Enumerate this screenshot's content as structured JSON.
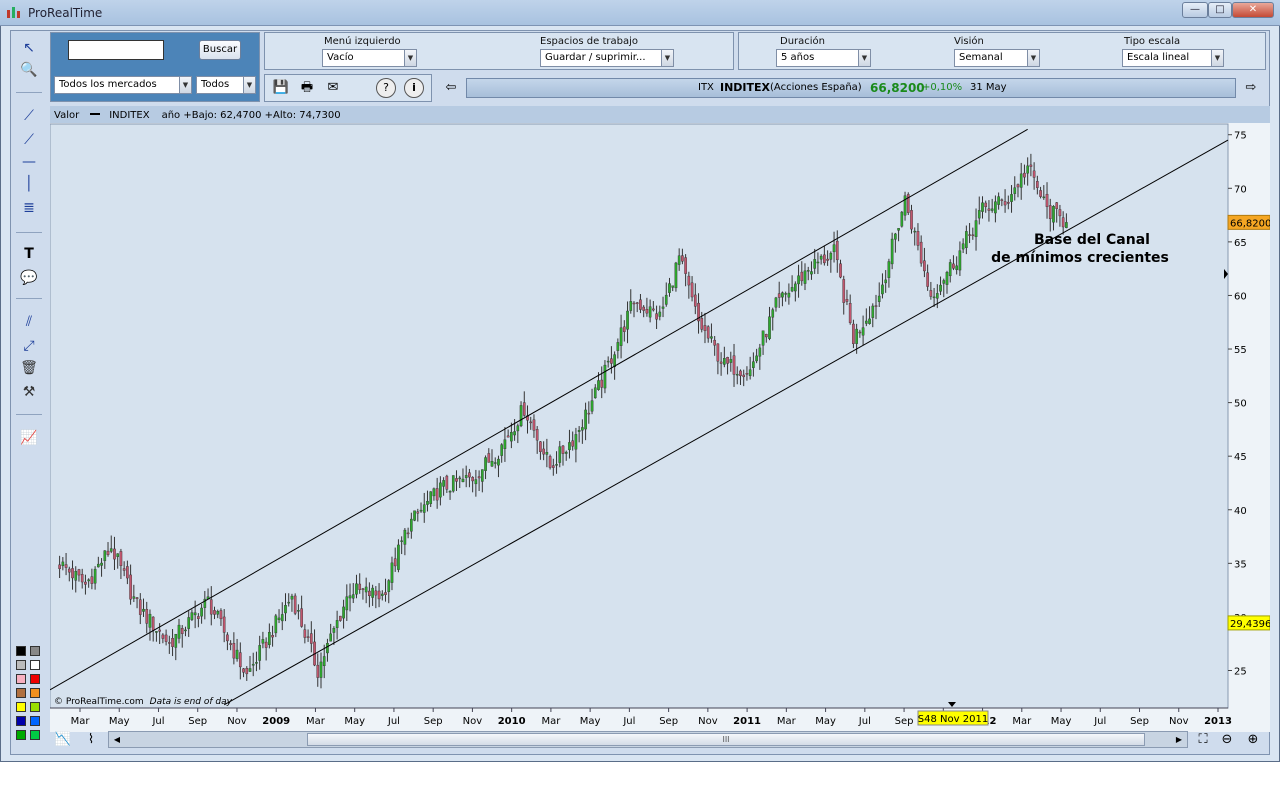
{
  "window": {
    "title": "ProRealTime",
    "min_label": "—",
    "max_label": "□",
    "close_label": "✕"
  },
  "search": {
    "input_value": "",
    "button_label": "Buscar",
    "market_select": "Todos los mercados",
    "type_select": "Todos"
  },
  "toolbar_panel": {
    "menu_label": "Menú izquierdo",
    "menu_value": "Vacío",
    "workspace_label": "Espacios de trabajo",
    "workspace_value": "Guardar / suprimir...",
    "duration_label": "Duración",
    "duration_value": "5 años",
    "vision_label": "Visión",
    "vision_value": "Semanal",
    "scale_label": "Tipo escala",
    "scale_value": "Escala lineal"
  },
  "instrument": {
    "code": "ITX",
    "name": "INDITEX",
    "market": "(Acciones España)",
    "price": "66,8200",
    "change": "+0,10%",
    "date": "31 May"
  },
  "chart_header": {
    "valor": "Valor",
    "series": "INDITEX",
    "stats": "año +Bajo: 62,4700 +Alto: 74,7300"
  },
  "annotation": {
    "line1": "Base del Canal",
    "line2": "de mínimos crecientes"
  },
  "footer": {
    "copyright": "© ProRealTime.com",
    "note": "Data is end of day",
    "cursor_label": "S48 Nov 2011"
  },
  "scroll": {
    "thumb_label": "III"
  },
  "colors": {
    "up": "#2ea82e",
    "down": "#c0566e",
    "bg": "#d6e2ee",
    "price_tag": "#f5a623",
    "low_tag": "#ffff00"
  },
  "chart_data": {
    "type": "candlestick",
    "title": "INDITEX",
    "x_ticks": [
      "Mar",
      "May",
      "Jul",
      "Sep",
      "Nov",
      "2009",
      "Mar",
      "May",
      "Jul",
      "Sep",
      "Nov",
      "2010",
      "Mar",
      "May",
      "Jul",
      "Sep",
      "Nov",
      "2011",
      "Mar",
      "May",
      "Jul",
      "Sep",
      "Nov",
      "2012",
      "Mar",
      "May",
      "Jul",
      "Sep",
      "Nov",
      "2013"
    ],
    "y_ticks": [
      25,
      30,
      35,
      40,
      45,
      50,
      55,
      60,
      65,
      70,
      75
    ],
    "ylim": [
      21.5,
      76
    ],
    "last_price": 66.82,
    "price_tag": "66,8200",
    "low_tag": "29,4396",
    "period": "Weekly",
    "keypoints": [
      {
        "t": 0,
        "v": 35
      },
      {
        "t": 8,
        "v": 33
      },
      {
        "t": 16,
        "v": 36.5
      },
      {
        "t": 24,
        "v": 31
      },
      {
        "t": 34,
        "v": 27.5
      },
      {
        "t": 46,
        "v": 31.5
      },
      {
        "t": 58,
        "v": 24.5
      },
      {
        "t": 72,
        "v": 32
      },
      {
        "t": 80,
        "v": 25
      },
      {
        "t": 90,
        "v": 32.5
      },
      {
        "t": 100,
        "v": 32
      },
      {
        "t": 108,
        "v": 38.5
      },
      {
        "t": 118,
        "v": 42
      },
      {
        "t": 128,
        "v": 43
      },
      {
        "t": 136,
        "v": 45.5
      },
      {
        "t": 144,
        "v": 49.5
      },
      {
        "t": 152,
        "v": 44
      },
      {
        "t": 160,
        "v": 47
      },
      {
        "t": 168,
        "v": 52
      },
      {
        "t": 178,
        "v": 59.5
      },
      {
        "t": 186,
        "v": 58
      },
      {
        "t": 192,
        "v": 63.5
      },
      {
        "t": 198,
        "v": 57.5
      },
      {
        "t": 206,
        "v": 53.5
      },
      {
        "t": 214,
        "v": 53
      },
      {
        "t": 222,
        "v": 59
      },
      {
        "t": 232,
        "v": 62.5
      },
      {
        "t": 240,
        "v": 64
      },
      {
        "t": 246,
        "v": 56
      },
      {
        "t": 254,
        "v": 60
      },
      {
        "t": 262,
        "v": 69
      },
      {
        "t": 270,
        "v": 60
      },
      {
        "t": 278,
        "v": 63.5
      },
      {
        "t": 286,
        "v": 68
      },
      {
        "t": 294,
        "v": 69
      },
      {
        "t": 300,
        "v": 72
      },
      {
        "t": 306,
        "v": 68
      },
      {
        "t": 312,
        "v": 66.8
      }
    ]
  }
}
